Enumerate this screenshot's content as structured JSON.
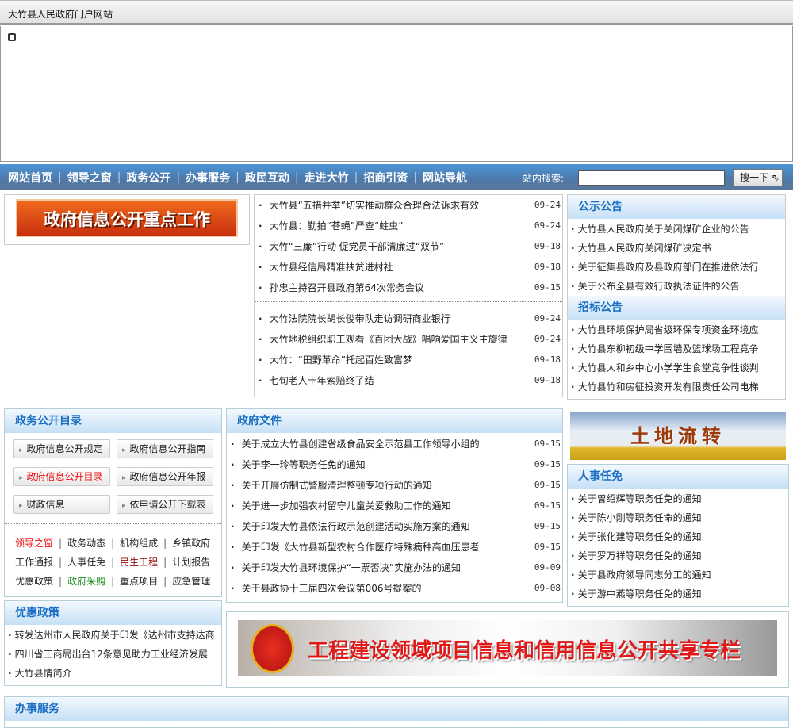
{
  "window": {
    "title": "大竹县人民政府门户网站"
  },
  "nav": {
    "items": [
      "网站首页",
      "领导之窗",
      "政务公开",
      "办事服务",
      "政民互动",
      "走进大竹",
      "招商引资",
      "网站导航"
    ],
    "search_label": "站内搜索:",
    "search_value": "",
    "search_button": "搜一下"
  },
  "banner_left": "政府信息公开重点工作",
  "news_top": [
    {
      "t": "大竹县“五措并举”切实推动群众合理合法诉求有效",
      "d": "09-24"
    },
    {
      "t": "大竹县：勤拍“苍蝇”严查“蛀虫”",
      "d": "09-24"
    },
    {
      "t": "大竹“三廉”行动 促党员干部清廉过“双节”",
      "d": "09-18"
    },
    {
      "t": "大竹县经信局精准扶贫进村社",
      "d": "09-18"
    },
    {
      "t": "孙忠主持召开县政府第64次常务会议",
      "d": "09-15"
    }
  ],
  "news_bottom": [
    {
      "t": "大竹法院院长胡长俊带队走访调研商业银行",
      "d": "09-24"
    },
    {
      "t": "大竹地税组织职工观看《百团大战》唱响爱国主义主旋律",
      "d": "09-24"
    },
    {
      "t": "大竹：“田野革命”托起百姓致富梦",
      "d": "09-18"
    },
    {
      "t": "七旬老人十年索赔终了结",
      "d": "09-18"
    }
  ],
  "notice": {
    "title": "公示公告",
    "items": [
      "大竹县人民政府关于关闭煤矿企业的公告",
      "大竹县人民政府关闭煤矿决定书",
      "关于征集县政府及县政府部门在推进依法行",
      "关于公布全县有效行政执法证件的公告"
    ]
  },
  "tender": {
    "title": "招标公告",
    "items": [
      "大竹县环境保护局省级环保专项资金环境应",
      "大竹县东柳初级中学围墙及篮球场工程竞争",
      "大竹县人和乡中心小学学生食堂竞争性谈判",
      "大竹县竹和房征投资开发有限责任公司电梯"
    ]
  },
  "catalog": {
    "title": "政务公开目录",
    "buttons": [
      "政府信息公开规定",
      "政府信息公开指南",
      "政府信息公开目录",
      "政府信息公开年报",
      "财政信息",
      "依申请公开下载表"
    ],
    "links": [
      [
        "领导之窗",
        "政务动态",
        "机构组成",
        "乡镇政府"
      ],
      [
        "工作通报",
        "人事任免",
        "民生工程",
        "计划报告"
      ],
      [
        "优惠政策",
        "政府采购",
        "重点项目",
        "应急管理"
      ]
    ],
    "colors": {
      "red": "#ee1111",
      "darkred": "#8b1010",
      "green": "#1a8a1a"
    }
  },
  "docs": {
    "title": "政府文件",
    "items": [
      {
        "t": "关于成立大竹县创建省级食品安全示范县工作领导小组的",
        "d": "09-15"
      },
      {
        "t": "关于李一玲等职务任免的通知",
        "d": "09-15"
      },
      {
        "t": "关于开展仿制式警服清理整顿专项行动的通知",
        "d": "09-15"
      },
      {
        "t": "关于进一步加强农村留守儿童关爱救助工作的通知",
        "d": "09-15"
      },
      {
        "t": "关于印发大竹县依法行政示范创建活动实施方案的通知",
        "d": "09-15"
      },
      {
        "t": "关于印发《大竹县新型农村合作医疗特殊病种高血压患者",
        "d": "09-15"
      },
      {
        "t": "关于印发大竹县环境保护“一票否决”实施办法的通知",
        "d": "09-09"
      },
      {
        "t": "关于县政协十三届四次会议第006号提案的",
        "d": "09-08"
      }
    ]
  },
  "land_banner": "土地流转",
  "personnel": {
    "title": "人事任免",
    "items": [
      "关于曾绍辉等职务任免的通知",
      "关于陈小刚等职务任命的通知",
      "关于张化建等职务任免的通知",
      "关于罗万祥等职务任免的通知",
      "关于县政府领导同志分工的通知",
      "关于游中燕等职务任免的通知"
    ]
  },
  "policy": {
    "title": "优惠政策",
    "items": [
      "转发达州市人民政府关于印发《达州市支持达商",
      "四川省工商局出台12条意见助力工业经济发展",
      "大竹县情简介"
    ]
  },
  "banner_bottom": "工程建设领域项目信息和信用信息公开共享专栏",
  "service": {
    "title": "办事服务"
  }
}
